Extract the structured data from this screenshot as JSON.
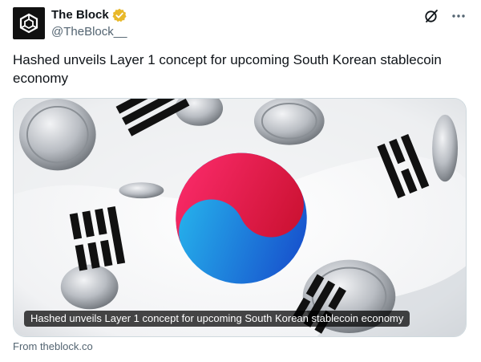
{
  "author": {
    "display_name": "The Block",
    "handle": "@TheBlock__",
    "verified": true,
    "verified_color": "#e8b829"
  },
  "tweet": {
    "text": "Hashed unveils Layer 1 concept for upcoming South Korean stablecoin economy"
  },
  "card": {
    "caption": "Hashed unveils Layer 1 concept for upcoming South Korean stablecoin economy",
    "source": "From theblock.co",
    "image_subject": "south-korean-flag-with-coins"
  },
  "icons": {
    "avatar": "cube-logo-icon",
    "grok": "grok-icon",
    "more": "more-options-icon"
  },
  "colors": {
    "text_primary": "#0f1419",
    "text_secondary": "#536471",
    "border": "#cfd9de",
    "flag_red": "#e8144e",
    "flag_blue": "#1a6fe0"
  }
}
